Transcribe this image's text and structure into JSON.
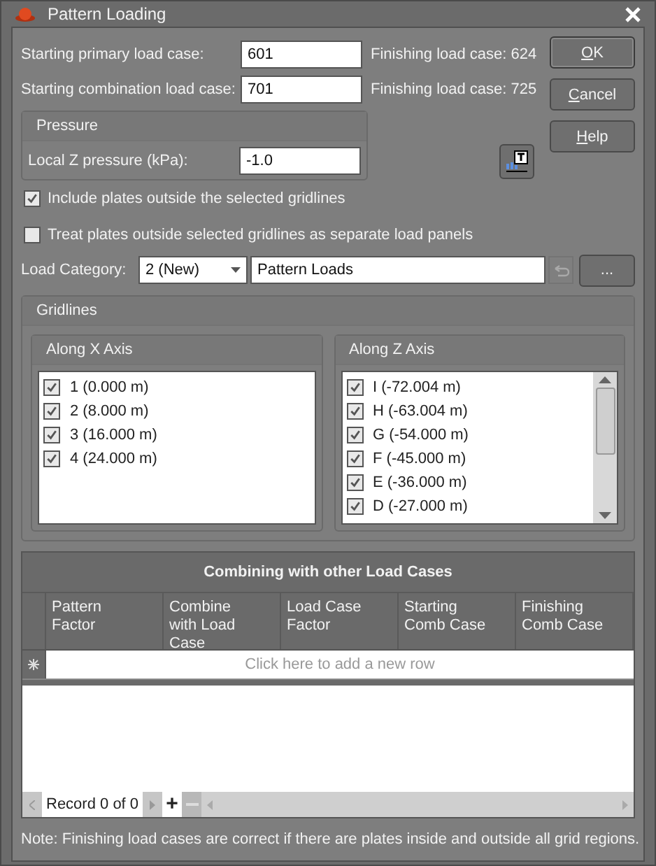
{
  "window": {
    "title": "Pattern Loading"
  },
  "fields": [
    {
      "label": "Starting primary load case:",
      "value": "601",
      "note": "Finishing load case: 624"
    },
    {
      "label": "Starting combination load case:",
      "value": "701",
      "note": "Finishing load case: 725"
    }
  ],
  "pressure": {
    "title": "Pressure",
    "label": "Local Z pressure (kPa):",
    "value": "-1.0"
  },
  "buttons": [
    {
      "label": "OK",
      "default": true
    },
    {
      "label": "Cancel",
      "default": false
    },
    {
      "label": "Help",
      "default": false
    }
  ],
  "options": [
    {
      "label": "Include plates outside the selected gridlines",
      "checked": true
    },
    {
      "label": "Treat plates outside selected gridlines as separate load panels",
      "checked": false
    }
  ],
  "load_category": {
    "label": "Load Category:",
    "value": "2 (New)",
    "name": "Pattern Loads",
    "undo_disabled": true,
    "more": "..."
  },
  "gridlines": {
    "title": "Gridlines",
    "groups": [
      {
        "title": "Along X Axis",
        "scrollable": false,
        "items": [
          {
            "label": "1 (0.000 m)",
            "checked": true
          },
          {
            "label": "2 (8.000 m)",
            "checked": true
          },
          {
            "label": "3 (16.000 m)",
            "checked": true
          },
          {
            "label": "4 (24.000 m)",
            "checked": true
          }
        ]
      },
      {
        "title": "Along Z Axis",
        "scrollable": true,
        "items": [
          {
            "label": "I (-72.004 m)",
            "checked": true
          },
          {
            "label": "H (-63.004 m)",
            "checked": true
          },
          {
            "label": "G (-54.000 m)",
            "checked": true
          },
          {
            "label": "F (-45.000 m)",
            "checked": true
          },
          {
            "label": "E (-36.000 m)",
            "checked": true
          },
          {
            "label": "D (-27.000 m)",
            "checked": true
          }
        ]
      }
    ]
  },
  "grid": {
    "title": "Combining with other Load Cases",
    "columns": [
      "Pattern Factor",
      "Combine with Load Case",
      "Load Case Factor",
      "Starting Comb Case",
      "Finishing Comb Case"
    ],
    "new_row_hint": "Click here to add a new row",
    "navigator": "Record 0 of 0",
    "nav_add": "+"
  },
  "note": "Note: Finishing load cases are correct if there are plates inside and outside all grid regions."
}
